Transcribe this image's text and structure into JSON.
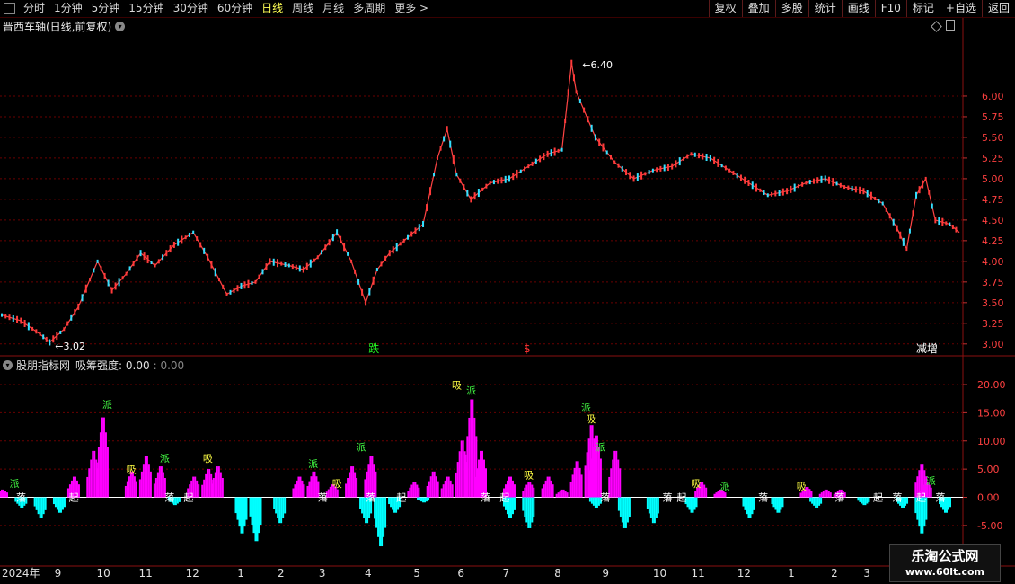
{
  "toolbar": {
    "periods": [
      "分时",
      "1分钟",
      "5分钟",
      "15分钟",
      "30分钟",
      "60分钟",
      "日线",
      "周线",
      "月线",
      "多周期",
      "更多 >"
    ],
    "active_period": "日线",
    "right_buttons": [
      "复权",
      "叠加",
      "多股",
      "统计",
      "画线",
      "F10",
      "标记",
      "+自选",
      "返回"
    ]
  },
  "main_panel": {
    "title": "晋西车轴(日线,前复权)",
    "high_label": "6.40",
    "low_label": "3.02",
    "markers": [
      {
        "text": "跌",
        "color": "#22ee22",
        "date_index": 0.383
      },
      {
        "text": "$",
        "color": "#ff3333",
        "date_index": 0.545
      },
      {
        "text": "减增",
        "color": "#ffffff",
        "date_index": 0.955
      }
    ]
  },
  "indicator_panel": {
    "name": "股朋指标网",
    "label": "吸筹强度: 0.00",
    "extra": ": 0.00"
  },
  "dates": [
    {
      "label": "2024年",
      "pos": 0.0
    },
    {
      "label": "9",
      "pos": 0.055
    },
    {
      "label": "10",
      "pos": 0.099
    },
    {
      "label": "11",
      "pos": 0.143
    },
    {
      "label": "12",
      "pos": 0.192
    },
    {
      "label": "1",
      "pos": 0.246
    },
    {
      "label": "2",
      "pos": 0.288
    },
    {
      "label": "3",
      "pos": 0.331
    },
    {
      "label": "4",
      "pos": 0.379
    },
    {
      "label": "5",
      "pos": 0.43
    },
    {
      "label": "6",
      "pos": 0.476
    },
    {
      "label": "7",
      "pos": 0.523
    },
    {
      "label": "8",
      "pos": 0.577
    },
    {
      "label": "9",
      "pos": 0.627
    },
    {
      "label": "10",
      "pos": 0.68
    },
    {
      "label": "11",
      "pos": 0.72
    },
    {
      "label": "12",
      "pos": 0.768
    },
    {
      "label": "1",
      "pos": 0.821
    },
    {
      "label": "2",
      "pos": 0.866
    },
    {
      "label": "3",
      "pos": 0.9
    }
  ],
  "watermark": {
    "brand": "乐淘公式网",
    "url": "www.60lt.com"
  },
  "chart_data": [
    {
      "type": "line",
      "title": "晋西车轴(日线,前复权)",
      "ylim": [
        2.9,
        6.75
      ],
      "yticks": [
        3.0,
        3.25,
        3.5,
        3.75,
        4.0,
        4.25,
        4.5,
        4.75,
        5.0,
        5.25,
        5.5,
        5.75,
        6.0
      ],
      "grid": true,
      "x": [
        0,
        0.02,
        0.04,
        0.05,
        0.065,
        0.08,
        0.1,
        0.115,
        0.13,
        0.145,
        0.16,
        0.18,
        0.2,
        0.215,
        0.235,
        0.25,
        0.265,
        0.28,
        0.3,
        0.315,
        0.33,
        0.35,
        0.365,
        0.38,
        0.392,
        0.405,
        0.42,
        0.44,
        0.455,
        0.465,
        0.475,
        0.49,
        0.51,
        0.53,
        0.55,
        0.57,
        0.585,
        0.595,
        0.6,
        0.62,
        0.64,
        0.66,
        0.68,
        0.7,
        0.72,
        0.74,
        0.76,
        0.78,
        0.8,
        0.82,
        0.84,
        0.86,
        0.88,
        0.9,
        0.92,
        0.935,
        0.945,
        0.955,
        0.965,
        0.975,
        0.99,
        1.0
      ],
      "values": [
        3.35,
        3.28,
        3.12,
        3.02,
        3.18,
        3.45,
        4.0,
        3.65,
        3.85,
        4.1,
        3.95,
        4.2,
        4.35,
        4.05,
        3.6,
        3.7,
        3.75,
        4.0,
        3.95,
        3.9,
        4.05,
        4.35,
        4.0,
        3.5,
        3.9,
        4.1,
        4.25,
        4.45,
        5.25,
        5.6,
        5.05,
        4.75,
        4.95,
        5.0,
        5.15,
        5.3,
        5.35,
        6.4,
        6.05,
        5.5,
        5.2,
        5.0,
        5.1,
        5.15,
        5.3,
        5.25,
        5.1,
        4.95,
        4.8,
        4.85,
        4.95,
        5.0,
        4.9,
        4.85,
        4.7,
        4.4,
        4.15,
        4.8,
        5.0,
        4.5,
        4.45,
        4.35
      ],
      "annotations": [
        "6.40",
        "3.02"
      ]
    },
    {
      "type": "bar",
      "title": "吸筹强度",
      "ylim": [
        -9,
        20
      ],
      "yticks": [
        -5,
        0,
        5,
        10,
        15,
        20
      ],
      "series": [
        {
          "name": "吸筹强度",
          "color": "#ff00ff",
          "x": [
            0,
            0.075,
            0.095,
            0.105,
            0.135,
            0.15,
            0.165,
            0.2,
            0.215,
            0.225,
            0.31,
            0.325,
            0.345,
            0.365,
            0.385,
            0.43,
            0.45,
            0.465,
            0.48,
            0.49,
            0.5,
            0.53,
            0.55,
            0.57,
            0.585,
            0.6,
            0.615,
            0.62,
            0.64,
            0.73,
            0.75,
            0.84,
            0.86,
            0.875,
            0.96,
            0.965
          ],
          "values": [
            1.5,
            4,
            9,
            15.5,
            5,
            8,
            6,
            4,
            5.5,
            6,
            4,
            5,
            2.5,
            6,
            8,
            3,
            5,
            4,
            11,
            19,
            9,
            4,
            3,
            4,
            1.5,
            7,
            14,
            12,
            9,
            3,
            1.5,
            2,
            1.5,
            1.5,
            6.5,
            3
          ]
        },
        {
          "name": "派发",
          "color": "#00ffff",
          "x": [
            0.02,
            0.04,
            0.06,
            0.18,
            0.25,
            0.265,
            0.29,
            0.38,
            0.395,
            0.41,
            0.44,
            0.53,
            0.55,
            0.62,
            0.65,
            0.68,
            0.72,
            0.78,
            0.81,
            0.85,
            0.9,
            0.94,
            0.96,
            0.985
          ],
          "values": [
            -2,
            -4,
            -3,
            -1.5,
            -7,
            -8.5,
            -5,
            -5,
            -9.5,
            -3,
            -1,
            -4,
            -6,
            -2,
            -6,
            -5,
            -3,
            -4,
            -3,
            -2,
            -1.5,
            -2,
            -7,
            -3
          ]
        }
      ],
      "labels": [
        "派",
        "起",
        "落",
        "吸"
      ]
    }
  ]
}
